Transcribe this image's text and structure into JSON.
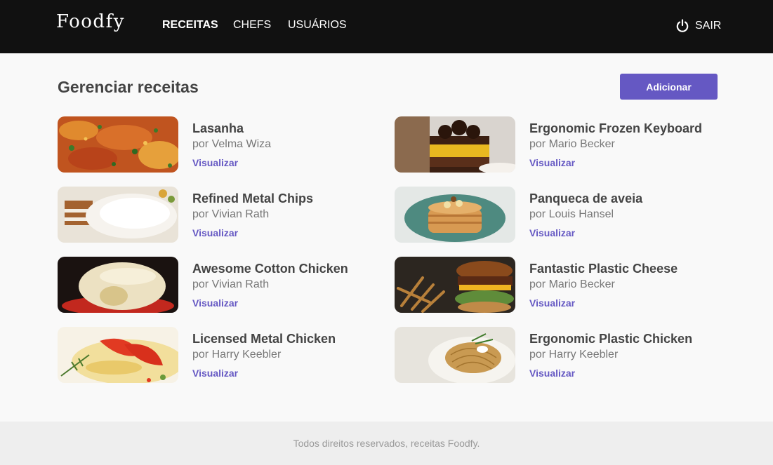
{
  "header": {
    "logo": "Foodfy",
    "nav": [
      {
        "label": "RECEITAS",
        "active": true
      },
      {
        "label": "CHEFS",
        "active": false
      },
      {
        "label": "USUÁRIOS",
        "active": false
      }
    ],
    "logout_icon": "power-icon",
    "logout_label": "SAIR"
  },
  "main": {
    "title": "Gerenciar receitas",
    "add_label": "Adicionar",
    "recipes": [
      {
        "title": "Lasanha",
        "author": "por Velma Wiza",
        "link": "Visualizar"
      },
      {
        "title": "Ergonomic Frozen Keyboard",
        "author": "por Mario Becker",
        "link": "Visualizar"
      },
      {
        "title": "Refined Metal Chips",
        "author": "por Vivian Rath",
        "link": "Visualizar"
      },
      {
        "title": "Panqueca de aveia",
        "author": "por Louis Hansel",
        "link": "Visualizar"
      },
      {
        "title": "Awesome Cotton Chicken",
        "author": "por Vivian Rath",
        "link": "Visualizar"
      },
      {
        "title": "Fantastic Plastic Cheese",
        "author": "por Mario Becker",
        "link": "Visualizar"
      },
      {
        "title": "Licensed Metal Chicken",
        "author": "por Harry Keebler",
        "link": "Visualizar"
      },
      {
        "title": "Ergonomic Plastic Chicken",
        "author": "por Harry Keebler",
        "link": "Visualizar"
      }
    ]
  },
  "footer": {
    "text": "Todos direitos reservados, receitas Foodfy."
  },
  "colors": {
    "accent": "#6558c3",
    "header_bg": "#111111",
    "page_bg": "#f9f9f9",
    "footer_bg": "#eeeeee"
  }
}
